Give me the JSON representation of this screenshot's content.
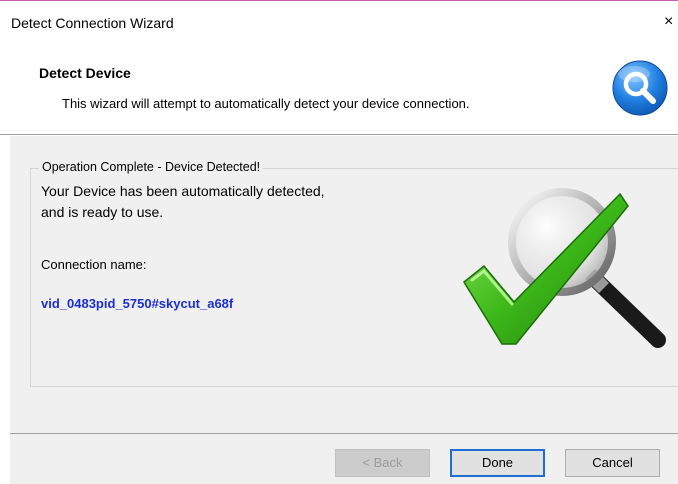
{
  "window": {
    "title": "Detect Connection Wizard",
    "close_glyph": "×"
  },
  "header": {
    "title": "Detect Device",
    "subtitle": "This wizard will attempt to automatically detect your device connection.",
    "icon": "magnifier-icon"
  },
  "group": {
    "legend": "Operation Complete - Device Detected!",
    "message_line1": "Your Device has been automatically detected,",
    "message_line2": "and is ready to use.",
    "connection_label": "Connection name:",
    "connection_value": "vid_0483pid_5750#skycut_a68f",
    "illustration": "checkmark-magnifier-icon"
  },
  "buttons": {
    "back": "< Back",
    "done": "Done",
    "cancel": "Cancel"
  },
  "colors": {
    "accent_blue": "#1b2ed6",
    "focus_blue": "#1f6fd2",
    "check_green": "#3cb81a",
    "dialog_gray": "#f0f0f0"
  }
}
